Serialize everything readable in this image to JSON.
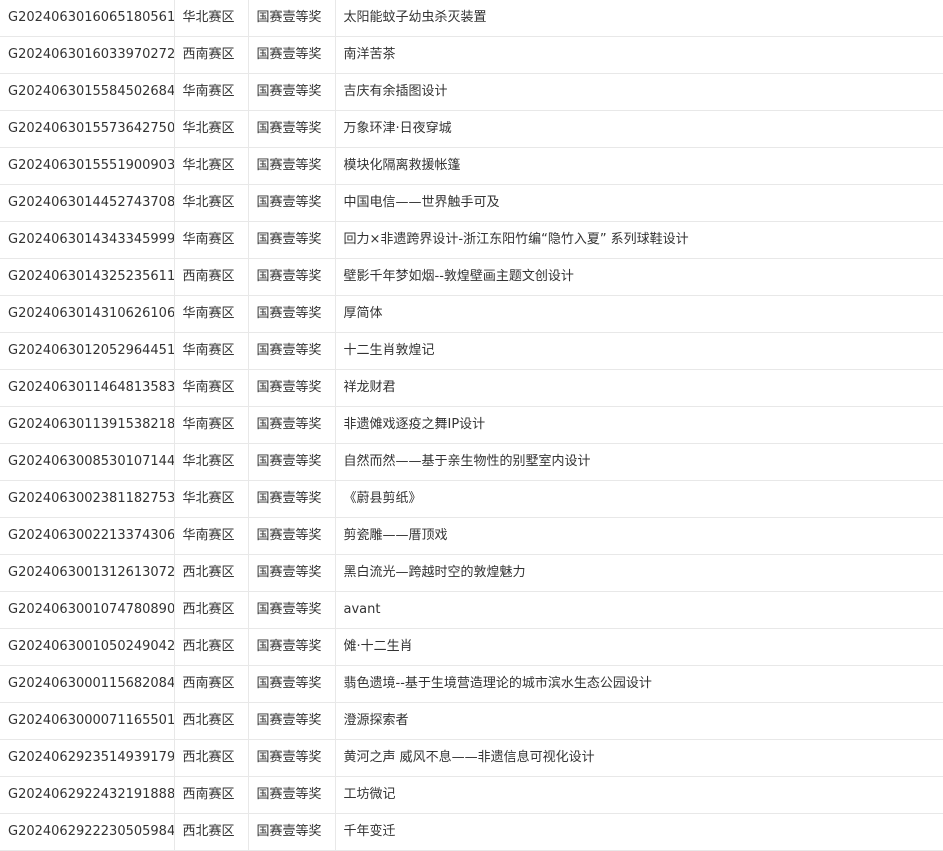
{
  "table": {
    "rows": [
      {
        "id": "G2024063016065180561",
        "region": "华北赛区",
        "award": "国赛壹等奖",
        "title": "太阳能蚊子幼虫杀灭装置"
      },
      {
        "id": "G2024063016033970272",
        "region": "西南赛区",
        "award": "国赛壹等奖",
        "title": "南洋苦茶"
      },
      {
        "id": "G2024063015584502684",
        "region": "华南赛区",
        "award": "国赛壹等奖",
        "title": "吉庆有余插图设计"
      },
      {
        "id": "G2024063015573642750",
        "region": "华北赛区",
        "award": "国赛壹等奖",
        "title": "万象环津·日夜穿城"
      },
      {
        "id": "G2024063015551900903",
        "region": "华北赛区",
        "award": "国赛壹等奖",
        "title": "模块化隔离救援帐篷"
      },
      {
        "id": "G2024063014452743708",
        "region": "华北赛区",
        "award": "国赛壹等奖",
        "title": "中国电信——世界触手可及"
      },
      {
        "id": "G2024063014343345999",
        "region": "华南赛区",
        "award": "国赛壹等奖",
        "title": "回力×非遗跨界设计-浙江东阳竹编“隐竹入夏” 系列球鞋设计"
      },
      {
        "id": "G2024063014325235611",
        "region": "西南赛区",
        "award": "国赛壹等奖",
        "title": "壁影千年梦如烟--敦煌壁画主题文创设计"
      },
      {
        "id": "G2024063014310626106",
        "region": "华南赛区",
        "award": "国赛壹等奖",
        "title": "厚简体"
      },
      {
        "id": "G2024063012052964451",
        "region": "华南赛区",
        "award": "国赛壹等奖",
        "title": "十二生肖敦煌记"
      },
      {
        "id": "G2024063011464813583",
        "region": "华南赛区",
        "award": "国赛壹等奖",
        "title": "祥龙财君"
      },
      {
        "id": "G2024063011391538218",
        "region": "华南赛区",
        "award": "国赛壹等奖",
        "title": "非遗傩戏逐疫之舞IP设计"
      },
      {
        "id": "G2024063008530107144",
        "region": "华北赛区",
        "award": "国赛壹等奖",
        "title": "自然而然——基于亲生物性的别墅室内设计"
      },
      {
        "id": "G2024063002381182753",
        "region": "华北赛区",
        "award": "国赛壹等奖",
        "title": "《蔚县剪纸》"
      },
      {
        "id": "G2024063002213374306",
        "region": "华南赛区",
        "award": "国赛壹等奖",
        "title": "剪瓷雕——厝顶戏"
      },
      {
        "id": "G2024063001312613072",
        "region": "西北赛区",
        "award": "国赛壹等奖",
        "title": "黑白流光—跨越时空的敦煌魅力"
      },
      {
        "id": "G2024063001074780890",
        "region": "西北赛区",
        "award": "国赛壹等奖",
        "title": "avant"
      },
      {
        "id": "G2024063001050249042",
        "region": "西北赛区",
        "award": "国赛壹等奖",
        "title": "傩·十二生肖"
      },
      {
        "id": "G2024063000115682084",
        "region": "西南赛区",
        "award": "国赛壹等奖",
        "title": "翡色遗境--基于生境营造理论的城市滨水生态公园设计"
      },
      {
        "id": "G2024063000071165501",
        "region": "西北赛区",
        "award": "国赛壹等奖",
        "title": "澄源探索者"
      },
      {
        "id": "G2024062923514939179",
        "region": "西北赛区",
        "award": "国赛壹等奖",
        "title": "黄河之声 威风不息——非遗信息可视化设计"
      },
      {
        "id": "G2024062922432191888",
        "region": "西南赛区",
        "award": "国赛壹等奖",
        "title": "工坊微记"
      },
      {
        "id": "G2024062922230505984",
        "region": "西北赛区",
        "award": "国赛壹等奖",
        "title": "千年变迁"
      }
    ]
  }
}
